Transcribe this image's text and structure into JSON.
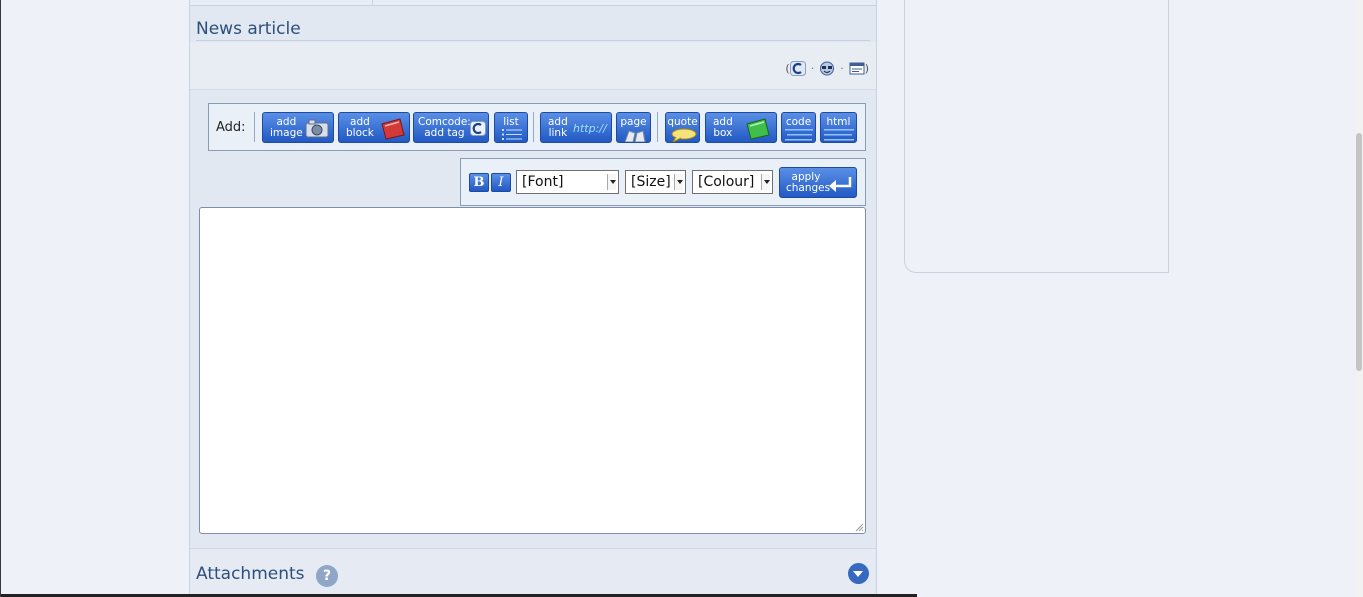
{
  "section": {
    "title": "News article"
  },
  "comcode_links": {
    "open_paren": "(",
    "sep": "·",
    "close_paren": ")"
  },
  "toolbar": {
    "add_label": "Add:",
    "buttons": {
      "add_image": "add\nimage",
      "add_block": "add\nblock",
      "comcode_tag": "Comcode:\nadd tag",
      "list": "list",
      "add_link": "add\nlink",
      "link_glyph": "http://",
      "page": "page",
      "quote": "quote",
      "add_box": "add\nbox",
      "code": "code",
      "html": "html"
    }
  },
  "format_bar": {
    "bold": "B",
    "italic": "I",
    "font": "[Font]",
    "size": "[Size]",
    "colour": "[Colour]",
    "apply": "apply\nchanges"
  },
  "editor": {
    "value": ""
  },
  "attachments": {
    "title": "Attachments",
    "help": "?"
  },
  "colors": {
    "accent": "#2d4f7c",
    "button_blue": "#2259c4"
  }
}
